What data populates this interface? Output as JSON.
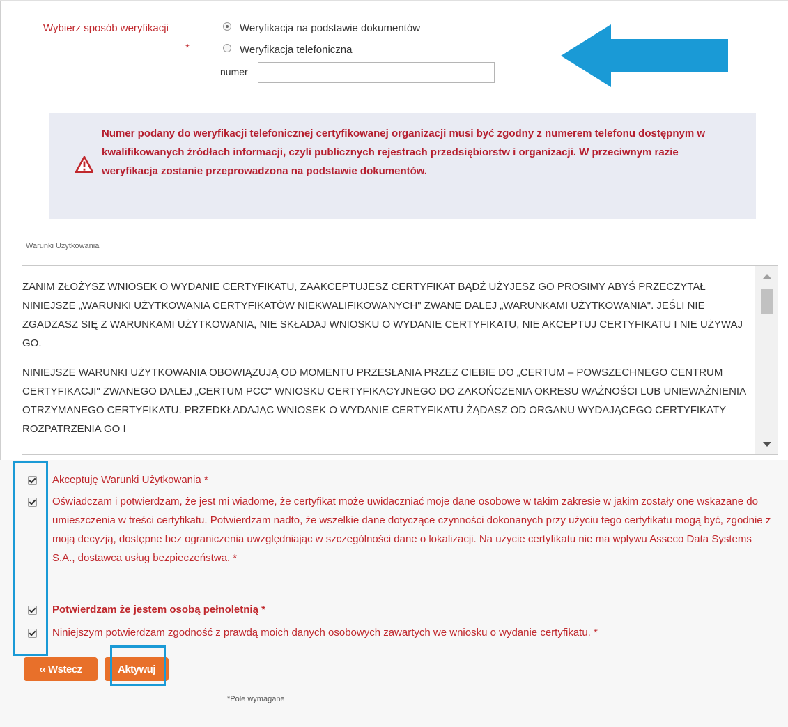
{
  "verification": {
    "label": "Wybierz sposób weryfikacji",
    "required_mark": "*",
    "options": [
      {
        "label": "Weryfikacja na podstawie dokumentów",
        "selected": true
      },
      {
        "label": "Weryfikacja telefoniczna",
        "selected": false
      }
    ],
    "phone_label": "numer",
    "phone_value": ""
  },
  "annotation_color": "#1a9ad6",
  "warning": {
    "icon": "warning-triangle-icon",
    "text": "Numer podany do weryfikacji telefonicznej certyfikowanej organizacji musi być zgodny z numerem telefonu dostępnym w kwalifikowanych źródłach informacji, czyli publicznych rejestrach przedsiębiorstw i organizacji. W przeciwnym razie weryfikacja zostanie przeprowadzona na podstawie dokumentów."
  },
  "terms": {
    "title": "Warunki Użytkowania",
    "paragraphs": [
      "ZANIM ZŁOŻYSZ WNIOSEK O WYDANIE CERTYFIKATU, ZAAKCEPTUJESZ CERTYFIKAT BĄDŹ UŻYJESZ GO PROSIMY ABYŚ PRZECZYTAŁ NINIEJSZE „WARUNKI UŻYTKOWANIA CERTYFIKATÓW NIEKWALIFIKOWANYCH\" ZWANE DALEJ „WARUNKAMI UŻYTKOWANIA\". JEŚLI NIE ZGADZASZ SIĘ Z WARUNKAMI UŻYTKOWANIA, NIE SKŁADAJ WNIOSKU O WYDANIE CERTYFIKATU, NIE AKCEPTUJ CERTYFIKATU I NIE UŻYWAJ GO.",
      "NINIEJSZE WARUNKI UŻYTKOWANIA OBOWIĄZUJĄ OD MOMENTU PRZESŁANIA PRZEZ CIEBIE DO „CERTUM – POWSZECHNEGO CENTRUM CERTYFIKACJI\" ZWANEGO DALEJ „CERTUM PCC\" WNIOSKU CERTYFIKACYJNEGO DO ZAKOŃCZENIA OKRESU WAŻNOŚCI LUB UNIEWAŻNIENIA OTRZYMANEGO CERTYFIKATU. PRZEDKŁADAJĄC WNIOSEK O WYDANIE CERTYFIKATU ŻĄDASZ OD ORGANU WYDAJĄCEGO CERTYFIKATY ROZPATRZENIA GO I"
    ]
  },
  "consents": [
    {
      "text": "Akceptuję Warunki Użytkowania *",
      "checked": true,
      "bold": false
    },
    {
      "text": "Oświadczam i potwierdzam, że jest mi wiadome, że certyfikat może uwidaczniać moje dane osobowe w takim zakresie w jakim zostały one wskazane do umieszczenia w treści certyfikatu. Potwierdzam nadto, że wszelkie dane dotyczące czynności dokonanych przy użyciu tego certyfikatu mogą być, zgodnie z moją decyzją, dostępne bez ograniczenia uwzględniając w szczególności dane o lokalizacji. Na użycie certyfikatu nie ma wpływu Asseco Data Systems S.A., dostawca usług bezpieczeństwa. *",
      "checked": true,
      "bold": false
    },
    {
      "text": "Potwierdzam że jestem osobą pełnoletnią *",
      "checked": true,
      "bold": true
    },
    {
      "text": "Niniejszym potwierdzam zgodność z prawdą moich danych osobowych zawartych we wniosku o wydanie certyfikatu. *",
      "checked": true,
      "bold": false
    }
  ],
  "buttons": {
    "back": "‹‹ Wstecz",
    "activate": "Aktywuj"
  },
  "required_note": "*Pole wymagane",
  "colors": {
    "required_red": "#c0282d",
    "warning_red": "#b52030",
    "warning_bg": "#e9ebf3",
    "button_orange": "#e8702a"
  }
}
